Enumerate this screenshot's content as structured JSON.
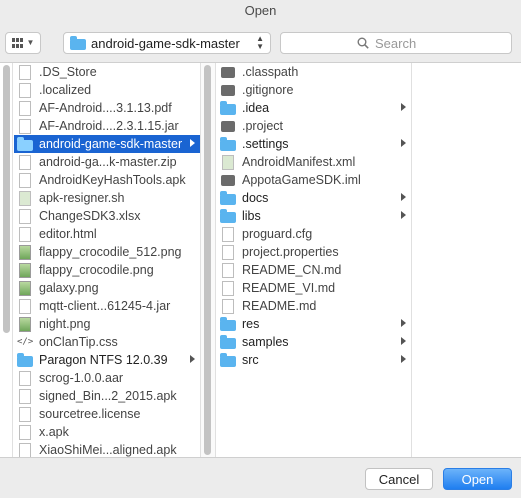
{
  "window": {
    "title": "Open"
  },
  "toolbar": {
    "path_label": "android-game-sdk-master",
    "search_placeholder": "Search"
  },
  "column1": [
    {
      "name": ".DS_Store",
      "icon": "doc",
      "dim": true
    },
    {
      "name": ".localized",
      "icon": "doc",
      "dim": true
    },
    {
      "name": "AF-Android....3.1.13.pdf",
      "icon": "doc",
      "dim": true
    },
    {
      "name": "AF-Android....2.3.1.15.jar",
      "icon": "doc",
      "dim": true
    },
    {
      "name": "android-game-sdk-master",
      "icon": "folder",
      "selected": true,
      "folder": true
    },
    {
      "name": "android-ga...k-master.zip",
      "icon": "zip",
      "dim": true
    },
    {
      "name": "AndroidKeyHashTools.apk",
      "icon": "doc",
      "dim": true
    },
    {
      "name": "apk-resigner.sh",
      "icon": "script",
      "dim": true
    },
    {
      "name": "ChangeSDK3.xlsx",
      "icon": "doc",
      "dim": true
    },
    {
      "name": "editor.html",
      "icon": "doc",
      "dim": true
    },
    {
      "name": "flappy_crocodile_512.png",
      "icon": "image",
      "dim": true
    },
    {
      "name": "flappy_crocodile.png",
      "icon": "image",
      "dim": true
    },
    {
      "name": "galaxy.png",
      "icon": "image",
      "dim": true
    },
    {
      "name": "mqtt-client...61245-4.jar",
      "icon": "doc",
      "dim": true
    },
    {
      "name": "night.png",
      "icon": "image",
      "dim": true
    },
    {
      "name": "onClanTip.css",
      "icon": "code",
      "dim": true
    },
    {
      "name": "Paragon NTFS 12.0.39",
      "icon": "folder",
      "folder": true
    },
    {
      "name": "scrog-1.0.0.aar",
      "icon": "doc",
      "dim": true
    },
    {
      "name": "signed_Bin...2_2015.apk",
      "icon": "doc",
      "dim": true
    },
    {
      "name": "sourcetree.license",
      "icon": "doc",
      "dim": true
    },
    {
      "name": "x.apk",
      "icon": "doc",
      "dim": true
    },
    {
      "name": "XiaoShiMei...aligned.apk",
      "icon": "doc",
      "dim": true
    }
  ],
  "column2": [
    {
      "name": ".classpath",
      "icon": "dark",
      "dim": true
    },
    {
      "name": ".gitignore",
      "icon": "dark",
      "dim": true
    },
    {
      "name": ".idea",
      "icon": "folder",
      "folder": true
    },
    {
      "name": ".project",
      "icon": "dark",
      "dim": true
    },
    {
      "name": ".settings",
      "icon": "folder",
      "folder": true
    },
    {
      "name": "AndroidManifest.xml",
      "icon": "script",
      "dim": true
    },
    {
      "name": "AppotaGameSDK.iml",
      "icon": "dark",
      "dim": true
    },
    {
      "name": "docs",
      "icon": "folder",
      "folder": true
    },
    {
      "name": "libs",
      "icon": "folder",
      "folder": true
    },
    {
      "name": "proguard.cfg",
      "icon": "doc",
      "dim": true
    },
    {
      "name": "project.properties",
      "icon": "doc",
      "dim": true
    },
    {
      "name": "README_CN.md",
      "icon": "doc",
      "dim": true
    },
    {
      "name": "README_VI.md",
      "icon": "doc",
      "dim": true
    },
    {
      "name": "README.md",
      "icon": "doc",
      "dim": true
    },
    {
      "name": "res",
      "icon": "folder",
      "folder": true
    },
    {
      "name": "samples",
      "icon": "folder",
      "folder": true
    },
    {
      "name": "src",
      "icon": "folder",
      "folder": true
    }
  ],
  "footer": {
    "cancel_label": "Cancel",
    "open_label": "Open"
  },
  "colors": {
    "selection": "#1a64d2",
    "folder": "#5ab4ef",
    "primary_button": "#1f7ef0"
  }
}
